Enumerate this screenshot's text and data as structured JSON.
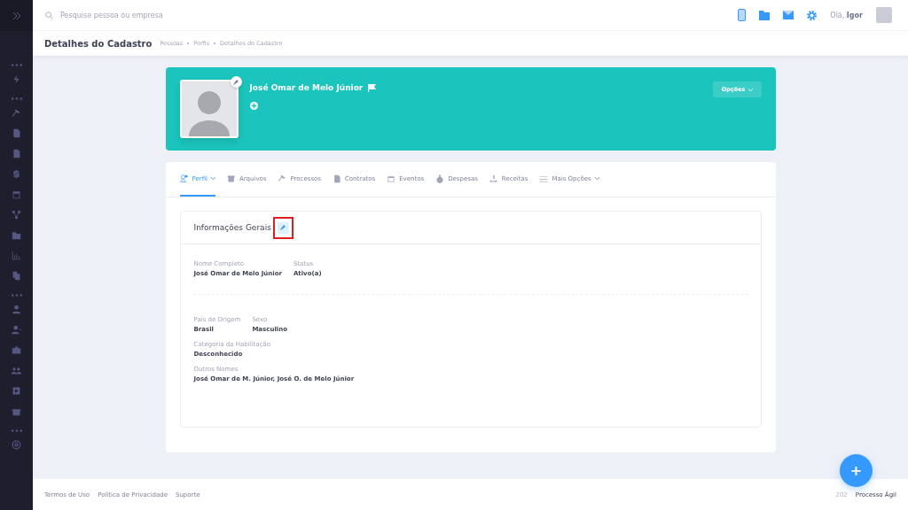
{
  "topbar": {
    "search": {
      "placeholder": "Pesquise pessoa ou empresa"
    },
    "greeting": "Olá,",
    "user": "Igor"
  },
  "subheader": {
    "title": "Detalhes do Cadastro",
    "breadcrumbs": [
      "Pessoas",
      "Perfis",
      "Detalhes do Cadastro"
    ]
  },
  "profile": {
    "name": "José Omar de Melo Júnior",
    "options_button": "Opções"
  },
  "tabs": [
    {
      "label": "Perfil",
      "selected": true,
      "dropdown": true
    },
    {
      "label": "Arquivos",
      "selected": false,
      "dropdown": false
    },
    {
      "label": "Processos",
      "selected": false,
      "dropdown": false
    },
    {
      "label": "Contratos",
      "selected": false,
      "dropdown": false
    },
    {
      "label": "Eventos",
      "selected": false,
      "dropdown": false
    },
    {
      "label": "Despesas",
      "selected": false,
      "dropdown": false
    },
    {
      "label": "Receitas",
      "selected": false,
      "dropdown": false
    },
    {
      "label": "Mais Opções",
      "selected": false,
      "dropdown": true
    }
  ],
  "info": {
    "title": "Informações Gerais",
    "edit_highlighted": true,
    "rows": [
      {
        "divider_after": true,
        "fields": [
          {
            "label": "Nome Completo",
            "value": "José Omar de Melo Júnior"
          },
          {
            "label": "Status",
            "value": "Ativo(a)"
          }
        ]
      },
      {
        "divider_after": false,
        "fields": [
          {
            "label": "País de Origem",
            "value": "Brasil"
          },
          {
            "label": "Sexo",
            "value": "Masculino"
          }
        ]
      },
      {
        "divider_after": false,
        "fields": [
          {
            "label": "Categoria da Habilitação",
            "value": "Desconhecido"
          }
        ]
      },
      {
        "divider_after": false,
        "fields": [
          {
            "label": "Outros Nomes",
            "value": "José Omar de M. Júnior, José O. de Melo Júnior"
          }
        ]
      }
    ]
  },
  "footer": {
    "links": [
      "Termos de Uso",
      "Política de Privacidade",
      "Suporte"
    ],
    "year": "202",
    "brand": "Processo Ágil"
  },
  "fab": {
    "label": "+"
  }
}
